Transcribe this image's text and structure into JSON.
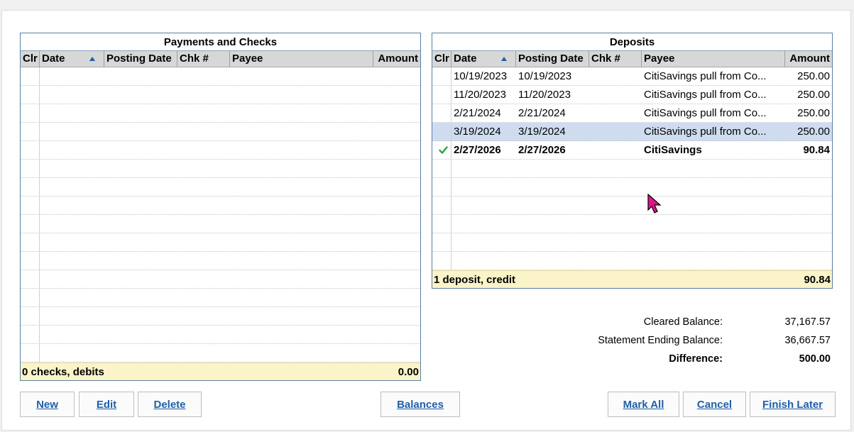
{
  "payments": {
    "title": "Payments and Checks",
    "columns": {
      "clr": "Clr",
      "date": "Date",
      "posting_date": "Posting Date",
      "chk": "Chk #",
      "payee": "Payee",
      "amount": "Amount"
    },
    "footer_label": "0 checks, debits",
    "footer_amount": "0.00"
  },
  "deposits": {
    "title": "Deposits",
    "columns": {
      "clr": "Clr",
      "date": "Date",
      "posting_date": "Posting Date",
      "chk": "Chk #",
      "payee": "Payee",
      "amount": "Amount"
    },
    "rows": [
      {
        "cleared": false,
        "date": "10/19/2023",
        "posting_date": "10/19/2023",
        "chk": "",
        "payee": "CitiSavings pull from Co...",
        "amount": "250.00"
      },
      {
        "cleared": false,
        "date": "11/20/2023",
        "posting_date": "11/20/2023",
        "chk": "",
        "payee": "CitiSavings pull from Co...",
        "amount": "250.00"
      },
      {
        "cleared": false,
        "date": "2/21/2024",
        "posting_date": "2/21/2024",
        "chk": "",
        "payee": "CitiSavings pull from Co...",
        "amount": "250.00"
      },
      {
        "cleared": false,
        "date": "3/19/2024",
        "posting_date": "3/19/2024",
        "chk": "",
        "payee": "CitiSavings pull from Co...",
        "amount": "250.00"
      },
      {
        "cleared": true,
        "date": "2/27/2026",
        "posting_date": "2/27/2026",
        "chk": "",
        "payee": "CitiSavings",
        "amount": "90.84"
      }
    ],
    "footer_label": "1 deposit, credit",
    "footer_amount": "90.84"
  },
  "summary": {
    "cleared_label": "Cleared Balance:",
    "cleared_value": "37,167.57",
    "ending_label": "Statement Ending Balance:",
    "ending_value": "36,667.57",
    "difference_label": "Difference:",
    "difference_value": "500.00"
  },
  "buttons": {
    "new": "New",
    "edit": "Edit",
    "delete": "Delete",
    "balances": "Balances",
    "mark_all": "Mark All",
    "cancel": "Cancel",
    "finish_later": "Finish Later"
  },
  "icons": {
    "cleared": "checkmark-icon",
    "cursor": "mouse-pointer-icon",
    "sort": "sort-ascending-icon"
  },
  "colors": {
    "accent": "#1f5fa8",
    "footer_bg": "#faf4c8",
    "selected_row": "#cfdcf0",
    "check": "#2aa44a",
    "cursor": "#e0158a"
  }
}
